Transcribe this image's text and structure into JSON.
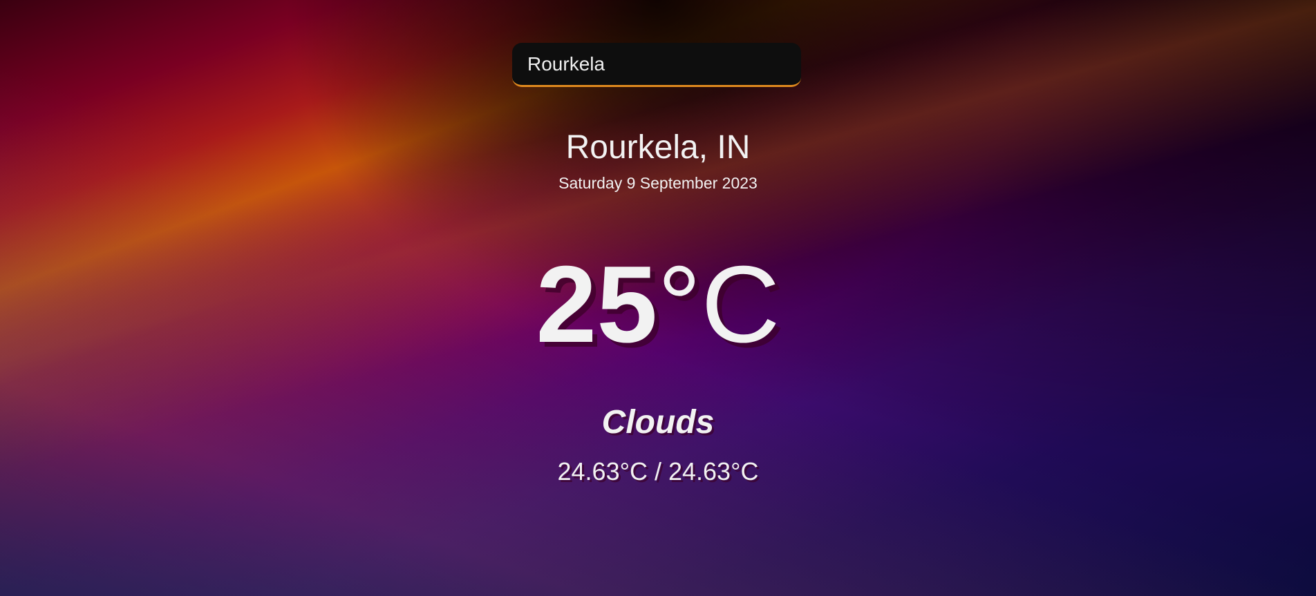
{
  "search": {
    "value": "Rourkela"
  },
  "location": {
    "city_country": "Rourkela, IN",
    "date": "Saturday 9 September 2023"
  },
  "weather": {
    "temp_value": "25",
    "temp_unit": "°C",
    "condition": "Clouds",
    "range": "24.63°C / 24.63°C"
  },
  "colors": {
    "accent": "#e08a1e",
    "search_bg": "#0e0e0e",
    "text": "#f2f2f2"
  }
}
